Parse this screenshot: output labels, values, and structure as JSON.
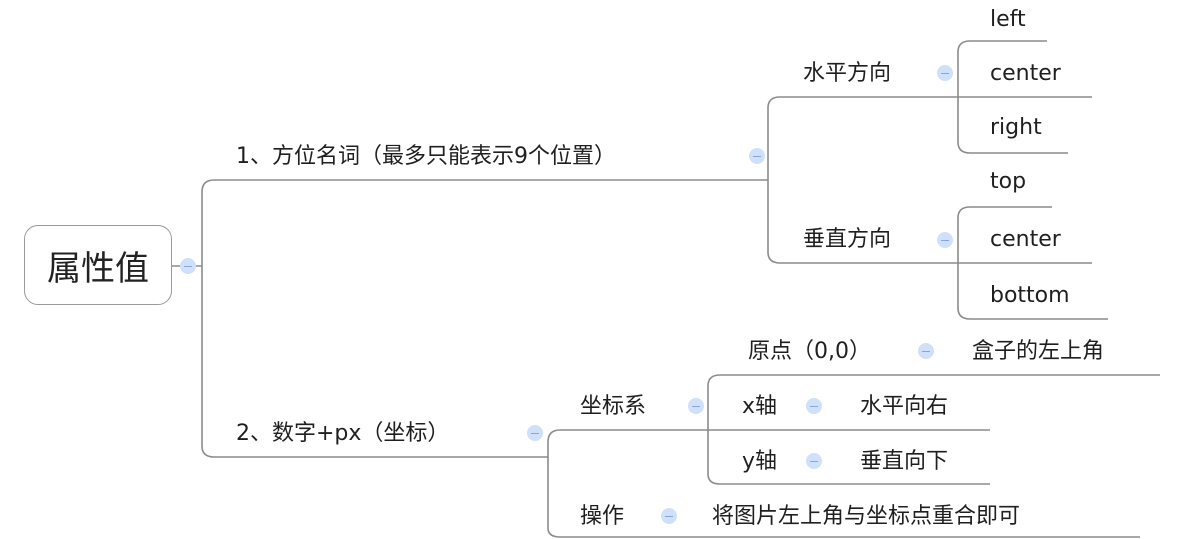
{
  "root": {
    "label": "属性值"
  },
  "branches": [
    {
      "label": "1、方位名词（最多只能表示9个位置）",
      "children": [
        {
          "label": "水平方向",
          "children": [
            "left",
            "center",
            "right"
          ]
        },
        {
          "label": "垂直方向",
          "children": [
            "top",
            "center",
            "bottom"
          ]
        }
      ]
    },
    {
      "label": "2、数字+px（坐标）",
      "children": [
        {
          "label": "坐标系",
          "children": [
            {
              "label": "原点（0,0）",
              "detail": "盒子的左上角"
            },
            {
              "label": "x轴",
              "detail": "水平向右"
            },
            {
              "label": "y轴",
              "detail": "垂直向下"
            }
          ]
        },
        {
          "label": "操作",
          "detail": "将图片左上角与坐标点重合即可"
        }
      ]
    }
  ],
  "colors": {
    "line": "#8c8c8c",
    "collapse_fill": "#cfe0fb",
    "text": "#1f1f1f"
  },
  "icons": {
    "collapse": "collapse-minus-icon"
  }
}
